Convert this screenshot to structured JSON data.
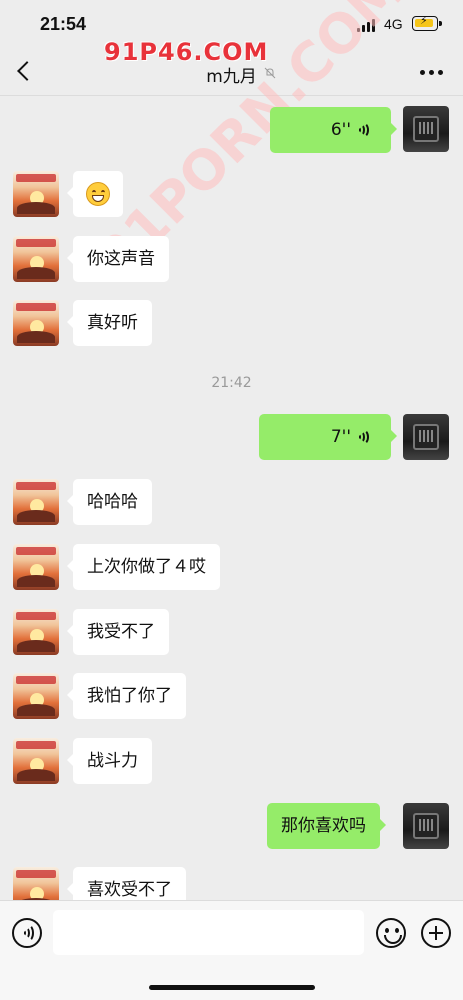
{
  "status_bar": {
    "time": "21:54",
    "network": "4G",
    "signal_icon": "signal-bars-icon",
    "battery_icon": "battery-charging-icon"
  },
  "header": {
    "title": "m九月",
    "back_icon": "chevron-left-icon",
    "mute_icon": "bell-muted-icon",
    "more_icon": "more-dots-icon"
  },
  "watermarks": {
    "top": "91P46.COM",
    "diagonal": "91PORN.COM"
  },
  "messages": [
    {
      "side": "right",
      "kind": "voice",
      "duration": "6''"
    },
    {
      "side": "left",
      "kind": "emoji",
      "emoji": "grinning-face"
    },
    {
      "side": "left",
      "kind": "text",
      "text": "你这声音"
    },
    {
      "side": "left",
      "kind": "text",
      "text": "真好听"
    },
    {
      "kind": "timestamp",
      "text": "21:42"
    },
    {
      "side": "right",
      "kind": "voice",
      "duration": "7''"
    },
    {
      "side": "left",
      "kind": "text",
      "text": "哈哈哈"
    },
    {
      "side": "left",
      "kind": "text",
      "text": "上次你做了４哎"
    },
    {
      "side": "left",
      "kind": "text",
      "text": "我受不了"
    },
    {
      "side": "left",
      "kind": "text",
      "text": "我怕了你了"
    },
    {
      "side": "left",
      "kind": "text",
      "text": "战斗力"
    },
    {
      "side": "right",
      "kind": "text",
      "text": "那你喜欢吗"
    },
    {
      "side": "left",
      "kind": "text",
      "text": "喜欢受不了"
    }
  ],
  "input_bar": {
    "voice_toggle_icon": "voice-input-icon",
    "placeholder": "",
    "emoji_icon": "smiley-icon",
    "plus_icon": "plus-circle-icon"
  },
  "colors": {
    "background": "#ededed",
    "self_bubble": "#95ec69",
    "other_bubble": "#ffffff",
    "watermark": "#e8323a"
  }
}
